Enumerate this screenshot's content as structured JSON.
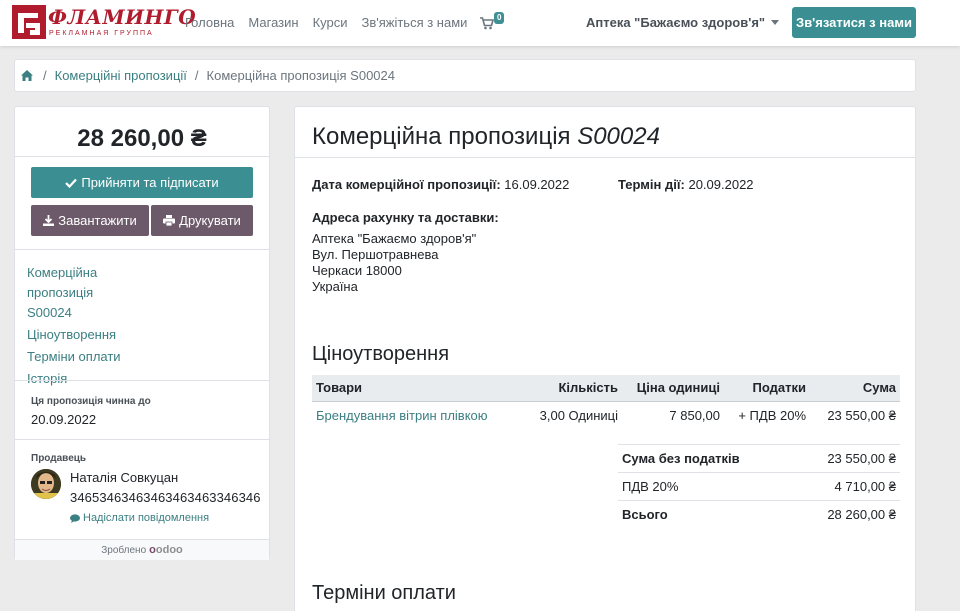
{
  "header": {
    "logo_word": "ФЛАМИНГО",
    "logo_sub": "РЕКЛАМНАЯ ГРУППА",
    "nav": [
      "Головна",
      "Магазин",
      "Курси",
      "Зв'яжіться з нами"
    ],
    "cart_count": "0",
    "account_name": "Аптека \"Бажаємо здоров'я\"",
    "contact_button": "Зв'язатися з нами"
  },
  "breadcrumb": {
    "items": [
      "Комерційні пропозиції",
      "Комерційна пропозиція S00024"
    ]
  },
  "sidebar": {
    "total": "28 260,00 ₴",
    "accept_button": "Прийняти та підписати",
    "download_button": "Завантажити",
    "print_button": "Друкувати",
    "links": [
      "Комерційна пропозиція S00024",
      "Ціноутворення",
      "Терміни оплати",
      "Історія"
    ],
    "valid_until_label": "Ця пропозиція чинна до",
    "valid_until_value": "20.09.2022",
    "seller_label": "Продавець",
    "seller_name": "Наталія Совкуцан",
    "seller_phone": "34653463463463463463346346",
    "send_message": "Надіслати повідомлення",
    "powered_by": "Зроблено",
    "powered_brand": "odoo"
  },
  "document": {
    "title_prefix": "Комерційна пропозиція",
    "title_ref": "S00024",
    "date_label": "Дата комерційної пропозиції:",
    "date_value": "16.09.2022",
    "expiry_label": "Термін дії:",
    "expiry_value": "20.09.2022",
    "address_label": "Адреса рахунку та доставки:",
    "address_lines": [
      "Аптека \"Бажаємо здоров'я\"",
      "Вул. Першотравнева",
      "Черкаси 18000",
      "Україна"
    ],
    "pricing_title": "Ціноутворення",
    "columns": [
      "Товари",
      "Кількість",
      "Ціна одиниці",
      "Податки",
      "Сума"
    ],
    "lines": [
      {
        "product": "Брендування вітрин плівкою",
        "quantity": "3,00 Одиниці",
        "unit_price": "7 850,00",
        "taxes": "+ ПДВ 20%",
        "amount": "23 550,00 ₴"
      }
    ],
    "totals": [
      {
        "label": "Сума без податків",
        "value": "23 550,00 ₴"
      },
      {
        "label": "ПДВ 20%",
        "value": "4 710,00 ₴"
      },
      {
        "label": "Всього",
        "value": "28 260,00 ₴"
      }
    ],
    "payment_terms_title": "Терміни оплати"
  },
  "colors": {
    "brand": "#b01c2e",
    "accent": "#3b8f92",
    "link": "#3b7f82",
    "dark_button": "#6c5a6a"
  }
}
